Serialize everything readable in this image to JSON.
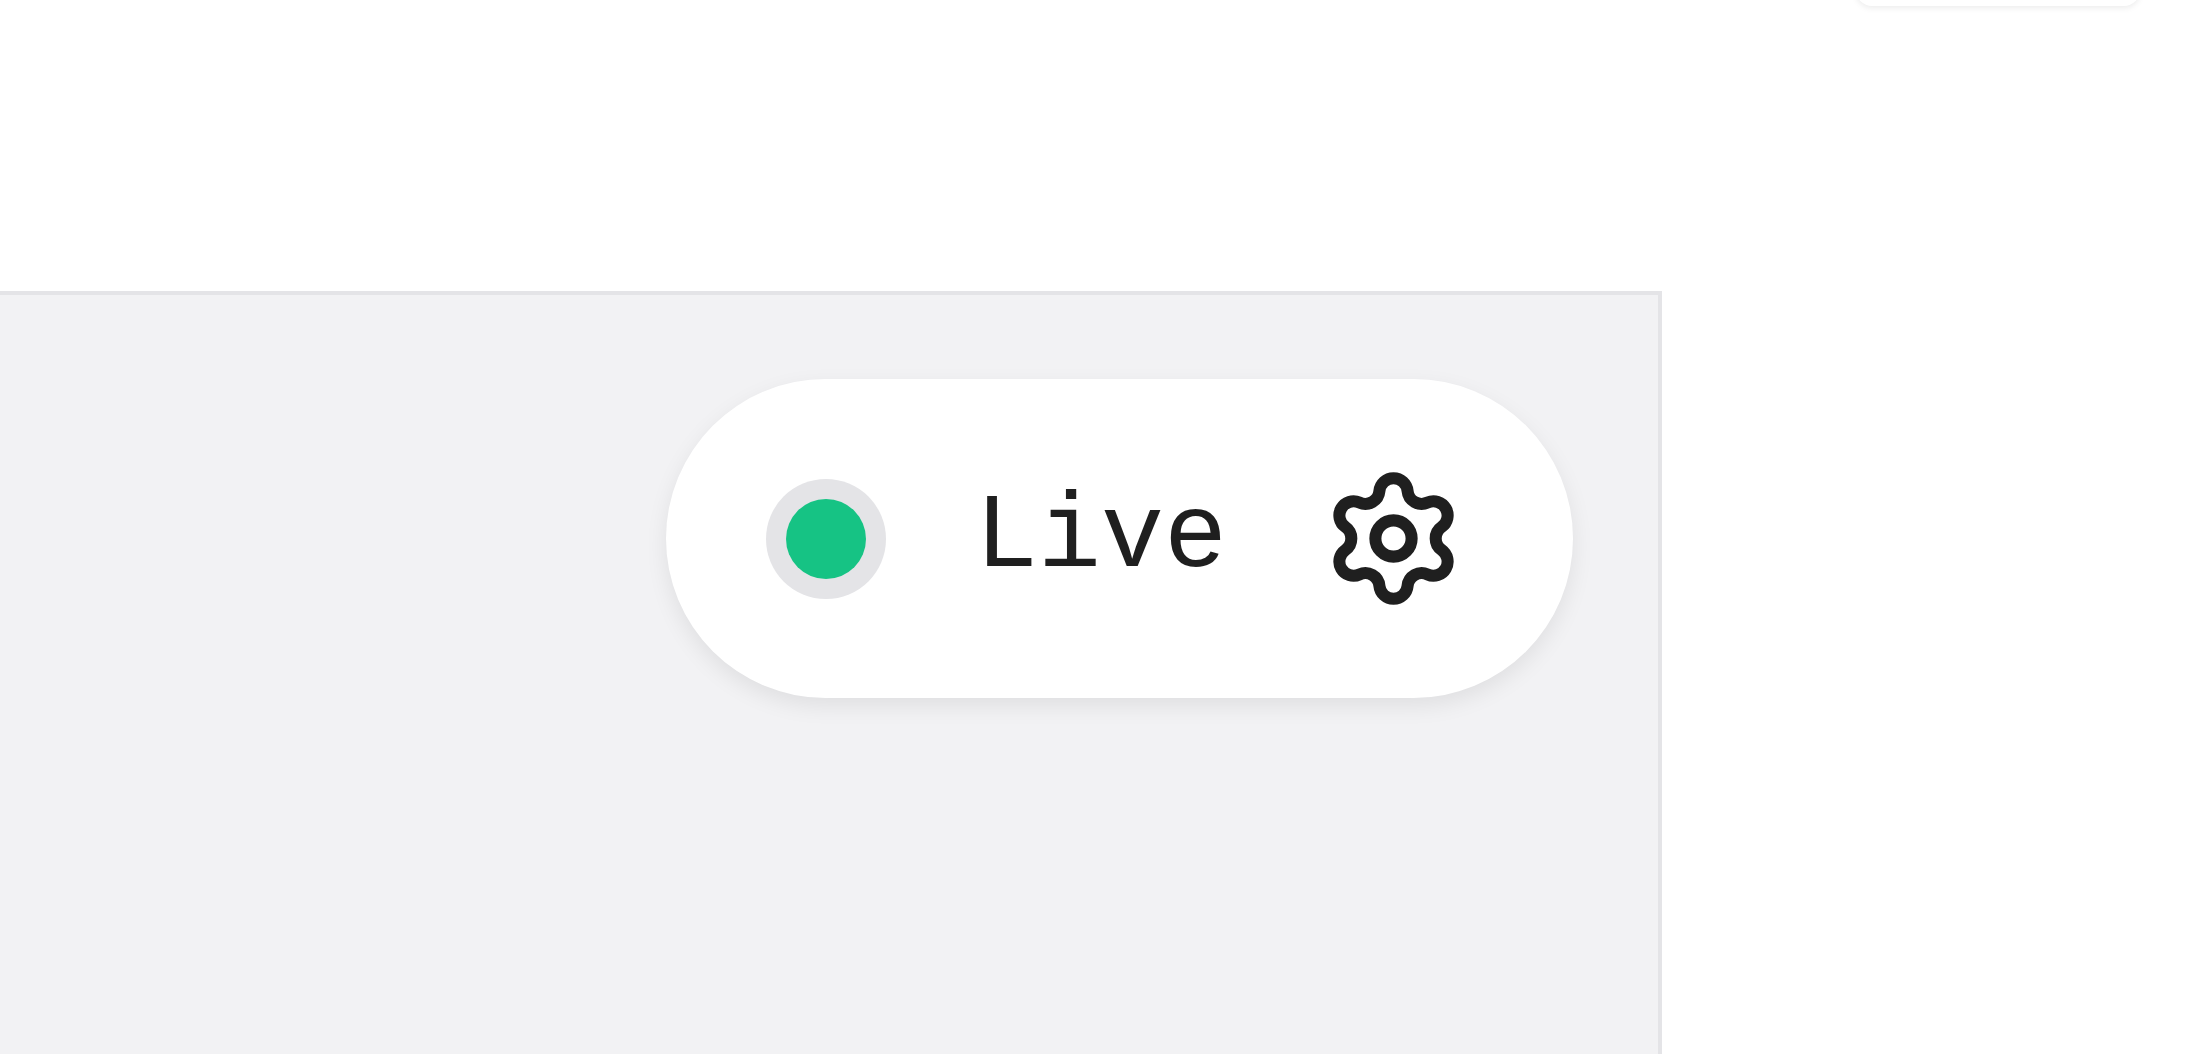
{
  "status_pill": {
    "label": "Live",
    "online": true
  }
}
